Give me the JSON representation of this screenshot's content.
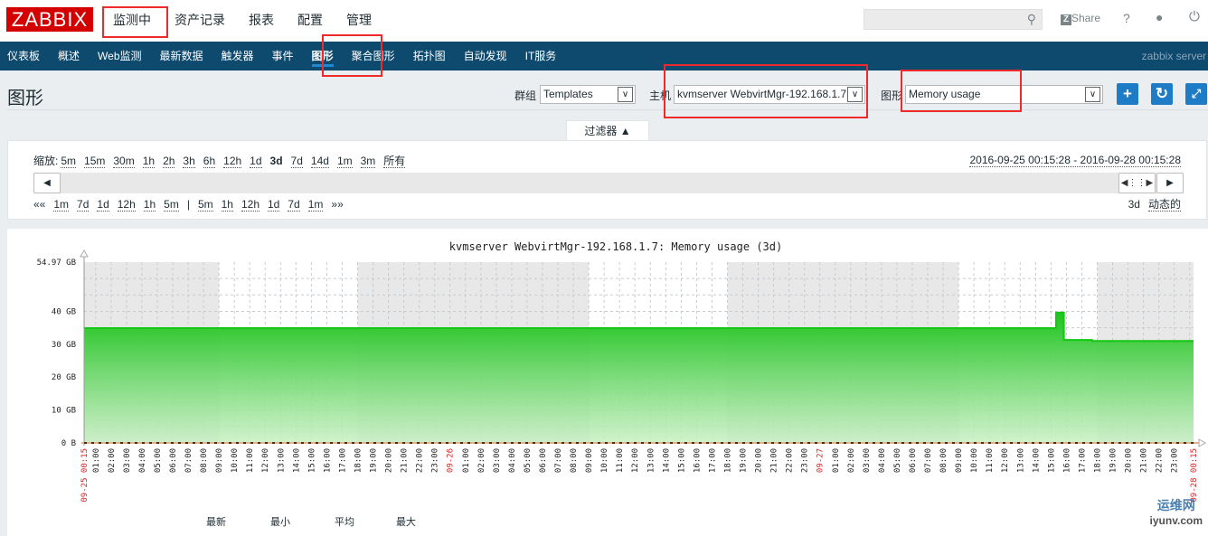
{
  "header": {
    "logo": "ZABBIX",
    "top_menu": [
      "监测中",
      "资产记录",
      "报表",
      "配置",
      "管理"
    ],
    "search_placeholder": "",
    "share": "Share",
    "help": "?",
    "icons": {
      "search": "search-icon",
      "share": "zabbix-share-icon",
      "user": "user-icon",
      "logout": "power-icon"
    }
  },
  "nav": {
    "items": [
      "仪表板",
      "概述",
      "Web监测",
      "最新数据",
      "触发器",
      "事件",
      "图形",
      "聚合图形",
      "拓扑图",
      "自动发现",
      "IT服务"
    ],
    "active": "图形",
    "server": "zabbix server"
  },
  "page": {
    "title": "图形",
    "group_label": "群组",
    "group_value": "Templates",
    "host_label": "主机",
    "host_value": "kvmserver WebvirtMgr-192.168.1.7",
    "graph_label": "图形",
    "graph_value": "Memory usage"
  },
  "filter": {
    "tab_label": "过滤器 ▲",
    "zoom_label": "缩放:",
    "zoom_options": [
      "5m",
      "15m",
      "30m",
      "1h",
      "2h",
      "3h",
      "6h",
      "12h",
      "1d",
      "3d",
      "7d",
      "14d",
      "1m",
      "3m",
      "所有"
    ],
    "zoom_selected": "3d",
    "period": "2016-09-25 00:15:28 - 2016-09-28 00:15:28",
    "nav_back": [
      "««",
      "1m",
      "7d",
      "1d",
      "12h",
      "1h",
      "5m"
    ],
    "separator": "|",
    "nav_fwd": [
      "5m",
      "1h",
      "12h",
      "1d",
      "7d",
      "1m",
      "»»"
    ],
    "duration": "3d",
    "dynamic": "动态的"
  },
  "chart_data": {
    "type": "area",
    "title": "kvmserver WebvirtMgr-192.168.1.7: Memory usage (3d)",
    "x_start": "2016-09-25 00:15",
    "x_end": "2016-09-28 00:15",
    "ylim": [
      0,
      54.97
    ],
    "y_unit": "GB",
    "y_ticks": [
      "0 B",
      "10 GB",
      "20 GB",
      "30 GB",
      "40 GB",
      "54.97 GB"
    ],
    "y_tick_values": [
      0,
      10,
      20,
      30,
      40,
      54.97
    ],
    "grid": true,
    "working_hours": "09:00-18:00",
    "x_ticks": [
      "09-25 00:15",
      "01:00",
      "02:00",
      "03:00",
      "04:00",
      "05:00",
      "06:00",
      "07:00",
      "08:00",
      "09:00",
      "10:00",
      "11:00",
      "12:00",
      "13:00",
      "14:00",
      "15:00",
      "16:00",
      "17:00",
      "18:00",
      "19:00",
      "20:00",
      "21:00",
      "22:00",
      "23:00",
      "09-26",
      "01:00",
      "02:00",
      "03:00",
      "04:00",
      "05:00",
      "06:00",
      "07:00",
      "08:00",
      "09:00",
      "10:00",
      "11:00",
      "12:00",
      "13:00",
      "14:00",
      "15:00",
      "16:00",
      "17:00",
      "18:00",
      "19:00",
      "20:00",
      "21:00",
      "22:00",
      "23:00",
      "09-27",
      "01:00",
      "02:00",
      "03:00",
      "04:00",
      "05:00",
      "06:00",
      "07:00",
      "08:00",
      "09:00",
      "10:00",
      "11:00",
      "12:00",
      "13:00",
      "14:00",
      "15:00",
      "16:00",
      "17:00",
      "18:00",
      "19:00",
      "20:00",
      "21:00",
      "22:00",
      "23:00",
      "09-28 00:15"
    ],
    "series": [
      {
        "color": "#1ec31e",
        "points": [
          [
            "2016-09-25 00:15",
            34.9
          ],
          [
            "2016-09-27 15:20",
            34.9
          ],
          [
            "2016-09-27 15:20",
            39.6
          ],
          [
            "2016-09-27 15:50",
            39.6
          ],
          [
            "2016-09-27 15:50",
            31.3
          ],
          [
            "2016-09-27 17:40",
            31.3
          ],
          [
            "2016-09-27 17:40",
            31.0
          ],
          [
            "2016-09-28 00:15",
            31.0
          ]
        ]
      }
    ],
    "legend_headers": [
      "最新",
      "最小",
      "平均",
      "最大"
    ]
  },
  "watermark": {
    "line1": "运维网",
    "line2": "iyunv.com"
  },
  "colors": {
    "brand": "#d40000",
    "nav": "#0e4a6e",
    "accent": "#1d7cc5",
    "highlight": "#ee2a2a"
  }
}
